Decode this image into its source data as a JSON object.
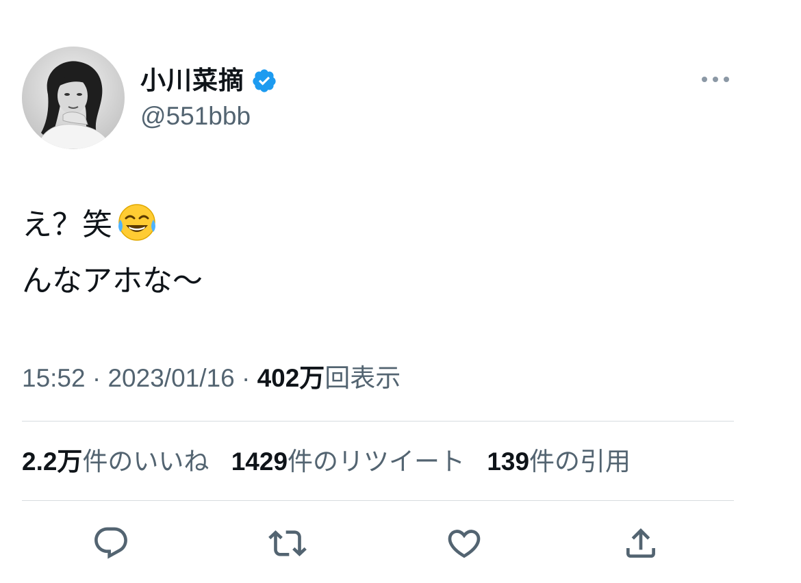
{
  "tweet": {
    "author": {
      "display_name": "小川菜摘",
      "handle": "@551bbb",
      "verified": true,
      "avatar": "avatar-photo-bw"
    },
    "text_lines": [
      "え？笑",
      "んなアホな〜"
    ],
    "emoji": "face-with-tears-of-joy",
    "meta": {
      "time": "15:52",
      "separator": "·",
      "date": "2023/01/16",
      "views_count": "402万",
      "views_label": "回表示"
    },
    "stats": {
      "likes_count": "2.2万",
      "likes_label": "件のいいね",
      "retweets_count": "1429",
      "retweets_label": "件のリツイート",
      "quotes_count": "139",
      "quotes_label": "件の引用"
    },
    "actions": [
      "reply-icon",
      "retweet-icon",
      "like-icon",
      "share-icon"
    ],
    "colors": {
      "text": "#0f1419",
      "secondary": "#536471",
      "verified": "#1d9bf0",
      "divider": "#d7dcdf"
    }
  }
}
